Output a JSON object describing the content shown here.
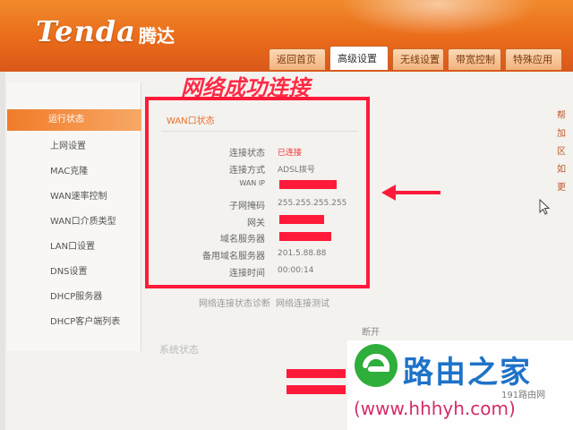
{
  "brand": {
    "logo": "Tenda",
    "name_cn": "腾达"
  },
  "tabs": [
    {
      "label": "返回首页",
      "active": false
    },
    {
      "label": "高级设置",
      "active": true
    },
    {
      "label": "无线设置",
      "active": false
    },
    {
      "label": "带宽控制",
      "active": false
    },
    {
      "label": "特殊应用",
      "active": false
    }
  ],
  "sidebar": {
    "items": [
      {
        "label": "运行状态",
        "active": true
      },
      {
        "label": "上网设置"
      },
      {
        "label": "MAC克隆"
      },
      {
        "label": "WAN速率控制"
      },
      {
        "label": "WAN口介质类型"
      },
      {
        "label": "LAN口设置"
      },
      {
        "label": "DNS设置"
      },
      {
        "label": "DHCP服务器"
      },
      {
        "label": "DHCP客户端列表"
      }
    ]
  },
  "wan_status": {
    "title": "WAN口状态",
    "rows": [
      {
        "label": "连接状态",
        "value": "已连接"
      },
      {
        "label": "连接方式",
        "value": "ADSL拨号"
      },
      {
        "label": "WAN IP",
        "value": ""
      },
      {
        "label": "子网掩码",
        "value": "255.255.255.255"
      },
      {
        "label": "网关",
        "value": ""
      },
      {
        "label": "域名服务器",
        "value": ""
      },
      {
        "label": "备用域名服务器",
        "value": "201.5.88.88"
      },
      {
        "label": "连接时间",
        "value": "00:00:14"
      }
    ],
    "links": [
      "网络连接状态诊断",
      "网络连接测试"
    ],
    "disconnect_label": "断开"
  },
  "system_status": {
    "title": "系统状态"
  },
  "right_panel": {
    "lines": [
      "帮",
      "加",
      "区",
      "如",
      "",
      "更"
    ]
  },
  "annotation": {
    "caption": "网络成功连接"
  },
  "watermark": {
    "name": "路由之家",
    "url": "(www.hhhyh.com)",
    "tag": "191路由网"
  },
  "colors": {
    "header": "#ea6b1a",
    "highlight": "#ff1a3a",
    "watermark_blue": "#1e73c8",
    "watermark_url": "#d42d6b"
  }
}
